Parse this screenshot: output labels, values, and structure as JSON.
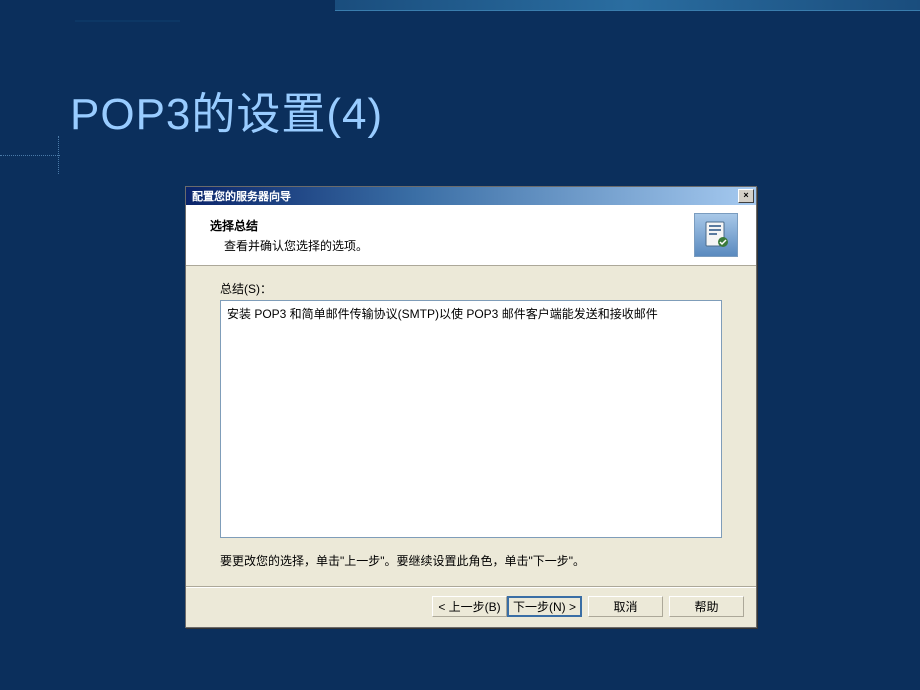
{
  "slide": {
    "title": "POP3的设置(4)"
  },
  "dialog": {
    "title": "配置您的服务器向导",
    "close_glyph": "×",
    "header": {
      "title": "选择总结",
      "subtitle": "查看并确认您选择的选项。"
    },
    "body": {
      "summary_label": "总结(S)：",
      "summary_text": "安装 POP3 和简单邮件传输协议(SMTP)以使 POP3 邮件客户端能发送和接收邮件",
      "hint": "要更改您的选择，单击\"上一步\"。要继续设置此角色，单击\"下一步\"。"
    },
    "buttons": {
      "back": "< 上一步(B)",
      "next": "下一步(N) >",
      "cancel": "取消",
      "help": "帮助"
    }
  }
}
